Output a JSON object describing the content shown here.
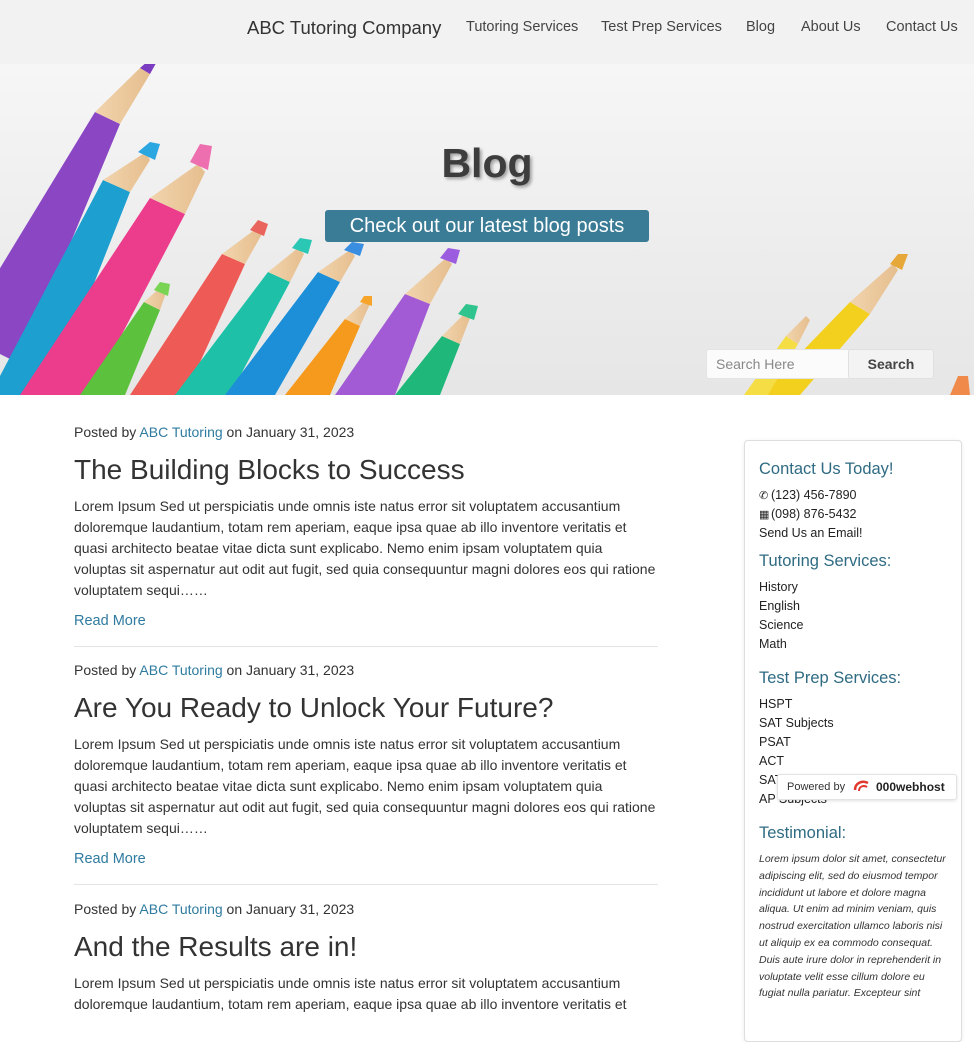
{
  "nav": {
    "brand": "ABC Tutoring Company",
    "links": [
      "Tutoring Services",
      "Test Prep Services",
      "Blog",
      "About Us",
      "Contact Us"
    ]
  },
  "hero": {
    "title": "Blog",
    "subtitle": "Check out our latest blog posts",
    "search_placeholder": "Search Here",
    "search_button": "Search"
  },
  "posts": [
    {
      "meta_prefix": "Posted by",
      "author": "ABC Tutoring",
      "meta_suffix": "on January 31, 2023",
      "title": "The Building Blocks to Success",
      "excerpt": "Lorem Ipsum Sed ut perspiciatis unde omnis iste natus error sit voluptatem accusantium doloremque laudantium, totam rem aperiam, eaque ipsa quae ab illo inventore veritatis et quasi architecto beatae vitae dicta sunt explicabo. Nemo enim ipsam voluptatem quia voluptas sit aspernatur aut odit aut fugit, sed quia consequuntur magni dolores eos qui ratione voluptatem sequi……",
      "read_more": "Read More"
    },
    {
      "meta_prefix": "Posted by",
      "author": "ABC Tutoring",
      "meta_suffix": "on January 31, 2023",
      "title": "Are You Ready to Unlock Your Future?",
      "excerpt": "Lorem Ipsum Sed ut perspiciatis unde omnis iste natus error sit voluptatem accusantium doloremque laudantium, totam rem aperiam, eaque ipsa quae ab illo inventore veritatis et quasi architecto beatae vitae dicta sunt explicabo. Nemo enim ipsam voluptatem quia voluptas sit aspernatur aut odit aut fugit, sed quia consequuntur magni dolores eos qui ratione voluptatem sequi……",
      "read_more": "Read More"
    },
    {
      "meta_prefix": "Posted by",
      "author": "ABC Tutoring",
      "meta_suffix": "on January 31, 2023",
      "title": "And the Results are in!",
      "excerpt": "Lorem Ipsum Sed ut perspiciatis unde omnis iste natus error sit voluptatem accusantium doloremque laudantium, totam rem aperiam, eaque ipsa quae ab illo inventore veritatis et"
    }
  ],
  "sidebar": {
    "contact_heading": "Contact Us Today!",
    "phone": "(123) 456-7890",
    "fax": "(098) 876-5432",
    "email": "Send Us an Email!",
    "tutoring_heading": "Tutoring Services:",
    "tutoring_items": [
      "History",
      "English",
      "Science",
      "Math"
    ],
    "testprep_heading": "Test Prep Services:",
    "testprep_items": [
      "HSPT",
      "SAT Subjects",
      "PSAT",
      "ACT",
      "SAT",
      "AP Subjects"
    ],
    "testimonial_heading": "Testimonial:",
    "testimonial": "Lorem ipsum dolor sit amet, consectetur adipiscing elit, sed do eiusmod tempor incididunt ut labore et dolore magna aliqua. Ut enim ad minim veniam, quis nostrud exercitation ullamco laboris nisi ut aliquip ex ea commodo consequat. Duis aute irure dolor in reprehenderit in voluptate velit esse cillum dolore eu fugiat nulla pariatur. Excepteur sint"
  },
  "badge": {
    "powered": "Powered by",
    "host": "000webhost"
  },
  "colors": {
    "accent": "#2f7ba0",
    "hero_subtitle_bg": "#3a7b96",
    "sidebar_heading": "#2f6b83"
  },
  "icons": {
    "phone": "phone-icon",
    "fax": "fax-icon"
  }
}
